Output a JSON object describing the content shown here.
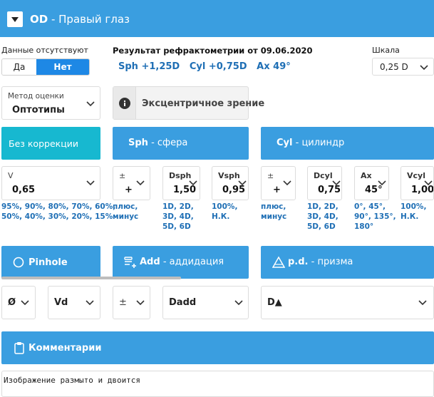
{
  "header": {
    "eye_code": "OD",
    "eye_name": "Правый глаз",
    "toggle_icon": "triangle-down-icon"
  },
  "no_data": {
    "label": "Данные отсутствуют",
    "yes": "Да",
    "no": "Нет",
    "selected": "Нет"
  },
  "refraction": {
    "title": "Результат рефрактометрии от 09.06.2020",
    "sph_label": "Sph",
    "sph_value": "+1,25D",
    "cyl_label": "Cyl",
    "cyl_value": "+0,75D",
    "ax_label": "Ax",
    "ax_value": "49°"
  },
  "scale": {
    "label": "Шкала",
    "value": "0,25 D"
  },
  "method": {
    "label": "Метод оценки",
    "value": "Оптотипы"
  },
  "eccentric": {
    "label": "Эксцентричное зрение",
    "icon": "info-icon"
  },
  "sections": {
    "no_correction": "Без коррекции",
    "sph": {
      "code": "Sph",
      "name": "сфера"
    },
    "cyl": {
      "code": "Cyl",
      "name": "цилиндр"
    }
  },
  "v": {
    "label": "V",
    "value": "0,65",
    "options_line1": "95%, 90%, 80%, 70%, 60%,",
    "options_line2": "50%, 40%, 30%, 20%, 15%"
  },
  "sph_fields": {
    "sign": {
      "label": "±",
      "value": "+",
      "hint1": "плюс,",
      "hint2": "минус"
    },
    "dsph": {
      "label": "Dsph",
      "value": "1,50",
      "hint1": "1D, 2D,",
      "hint2": "3D, 4D,",
      "hint3": "5D, 6D"
    },
    "vsph": {
      "label": "Vsph",
      "value": "0,95",
      "hint1": "100%,",
      "hint2": "Н.К."
    }
  },
  "cyl_fields": {
    "sign": {
      "label": "±",
      "value": "+",
      "hint1": "плюс,",
      "hint2": "минус"
    },
    "dcyl": {
      "label": "Dcyl",
      "value": "0,75",
      "hint1": "1D, 2D,",
      "hint2": "3D, 4D,",
      "hint3": "5D, 6D"
    },
    "ax": {
      "label": "Ax",
      "value": "45°",
      "hint1": "0°, 45°,",
      "hint2": "90°, 135°,",
      "hint3": "180°"
    },
    "vcyl": {
      "label": "Vcyl",
      "value": "1,00",
      "hint1": "100%,",
      "hint2": "Н.К."
    }
  },
  "pinhole": {
    "label": "Pinhole",
    "icon": "circle-icon"
  },
  "add": {
    "code": "Add",
    "name": "аддидация",
    "icon": "stack-plus-icon"
  },
  "pd": {
    "code": "p.d.",
    "name": "призма",
    "icon": "prism-triangle-icon"
  },
  "bottom_selects": {
    "diam": "Ø",
    "vd": "Vd",
    "sign": "±",
    "dadd": "Dadd",
    "dprism": "D▲"
  },
  "comments": {
    "label": "Комментарии",
    "icon": "clipboard-icon",
    "text": "Изображение размыто и двоится"
  },
  "colors": {
    "primary": "#3a9ee0",
    "teal": "#17b8d0",
    "selected": "#1e88e5",
    "link": "#1f6fb5"
  }
}
